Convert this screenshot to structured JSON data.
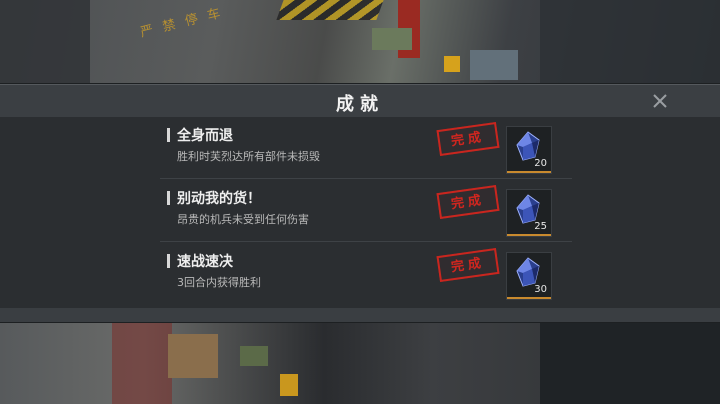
{
  "dialog": {
    "title": "成就",
    "close_icon": "close-x-icon"
  },
  "background": {
    "sign_text": "严禁停车"
  },
  "achievements": [
    {
      "name": "全身而退",
      "description": "胜利时芙烈达所有部件未损毁",
      "stamp": "完成",
      "reward_icon": "blue-crystal-icon",
      "reward_count": "20"
    },
    {
      "name": "别动我的货！",
      "description": "昂贵的机兵未受到任何伤害",
      "stamp": "完成",
      "reward_icon": "blue-crystal-icon",
      "reward_count": "25"
    },
    {
      "name": "速战速决",
      "description": "3回合内获得胜利",
      "stamp": "完成",
      "reward_icon": "blue-crystal-icon",
      "reward_count": "30"
    }
  ],
  "colors": {
    "stamp_red": "#c9261f",
    "reward_accent": "#c98a2e",
    "panel": "#2b2e31"
  }
}
